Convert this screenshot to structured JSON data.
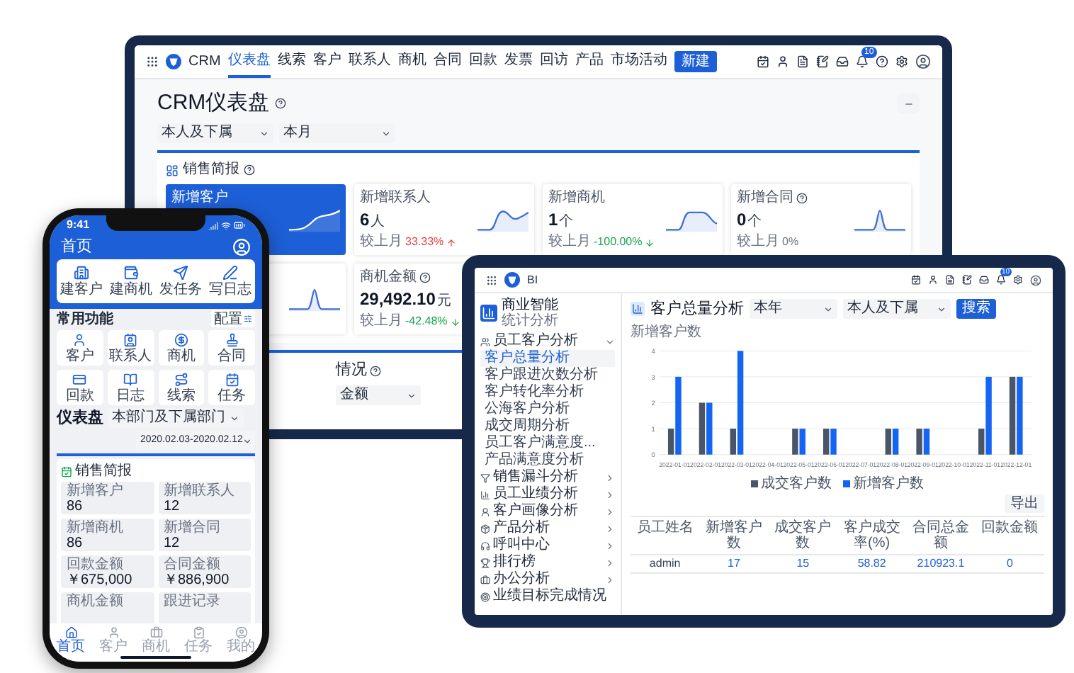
{
  "monitor": {
    "app_name": "CRM",
    "nav": [
      {
        "label": "仪表盘",
        "selected": true
      },
      {
        "label": "线索",
        "selected": false
      },
      {
        "label": "客户",
        "selected": false
      },
      {
        "label": "联系人",
        "selected": false
      },
      {
        "label": "商机",
        "selected": false
      },
      {
        "label": "合同",
        "selected": false
      },
      {
        "label": "回款",
        "selected": false
      },
      {
        "label": "发票",
        "selected": false
      },
      {
        "label": "回访",
        "selected": false
      },
      {
        "label": "产品",
        "selected": false
      },
      {
        "label": "市场活动",
        "selected": false
      }
    ],
    "new_button": "新建",
    "badge": "10",
    "title": "CRM仪表盘",
    "filters": [
      "本人及下属",
      "本月"
    ],
    "briefing": {
      "title": "销售简报",
      "cards": [
        {
          "label": "新增客户",
          "help": false,
          "selected": true,
          "sparkline": {
            "kind": "rise"
          }
        },
        {
          "label": "新增联系人",
          "help": false,
          "value": "6",
          "unit": "人",
          "compare_label": "较上月",
          "change": "33.33%",
          "arrow": {
            "kind": "up"
          },
          "selected": false,
          "sparkline": {
            "kind": "hump"
          }
        },
        {
          "label": "新增商机",
          "help": false,
          "value": "1",
          "unit": "个",
          "compare_label": "较上月",
          "change": "-100.00%",
          "arrow": {
            "kind": "down"
          },
          "selected": false,
          "sparkline": {
            "kind": "plateau"
          }
        },
        {
          "label": "新增合同",
          "help": true,
          "value": "0",
          "unit": "个",
          "compare_label": "较上月",
          "change": "0%",
          "selected": false,
          "sparkline": {
            "kind": "peak"
          }
        },
        {
          "selected": false,
          "sparkline": {
            "kind": "peak"
          }
        },
        {
          "label": "商机金额",
          "help": true,
          "value": "29,492.10",
          "unit": "元",
          "compare_label": "较上月",
          "change": "-42.48%",
          "arrow": {
            "kind": "down"
          },
          "selected": false
        }
      ]
    },
    "overview": {
      "title": "情况",
      "filter": "金额"
    }
  },
  "tablet": {
    "app_name": "BI",
    "badge": "10",
    "sidebar": {
      "title": "商业智能",
      "subtitle": "统计分析",
      "groups": [
        {
          "label": "员工客户分析",
          "expanded": true,
          "children": [
            {
              "label": "客户总量分析",
              "selected": true
            },
            {
              "label": "客户跟进次数分析",
              "selected": false
            },
            {
              "label": "客户转化率分析",
              "selected": false
            },
            {
              "label": "公海客户分析",
              "selected": false
            },
            {
              "label": "成交周期分析",
              "selected": false
            },
            {
              "label": "员工客户满意度...",
              "selected": false
            },
            {
              "label": "产品满意度分析",
              "selected": false
            }
          ]
        },
        {
          "label": "销售漏斗分析",
          "expanded": false
        },
        {
          "label": "员工业绩分析",
          "expanded": false
        },
        {
          "label": "客户画像分析",
          "expanded": false
        },
        {
          "label": "产品分析",
          "expanded": false
        },
        {
          "label": "呼叫中心",
          "expanded": false
        },
        {
          "label": "排行榜",
          "expanded": false
        },
        {
          "label": "办公分析",
          "expanded": false
        },
        {
          "label": "业绩目标完成情况"
        }
      ]
    },
    "page_title": "客户总量分析",
    "filters": [
      "本年",
      "本人及下属"
    ],
    "search_button": "搜索",
    "chart_data": {
      "type": "bar",
      "ylabel": "新增客户数",
      "categories": [
        "2022-01-01",
        "2022-02-01",
        "2022-03-01",
        "2022-04-01",
        "2022-05-01",
        "2022-06-01",
        "2022-07-01",
        "2022-08-01",
        "2022-09-01",
        "2022-10-01",
        "2022-11-01",
        "2022-12-01"
      ],
      "series": [
        {
          "name": "成交客户数",
          "color": "#4a5568",
          "values": [
            1,
            2,
            1,
            null,
            1,
            1,
            null,
            1,
            1,
            null,
            1,
            3
          ]
        },
        {
          "name": "新增客户数",
          "color": "#1565f5",
          "values": [
            3,
            2,
            4,
            null,
            1,
            1,
            null,
            1,
            1,
            null,
            3,
            3
          ]
        }
      ],
      "ylim": [
        0,
        4
      ],
      "yticks": [
        0,
        1,
        2,
        3,
        4
      ],
      "grid": true
    },
    "export_button": "导出",
    "table": {
      "columns": [
        "员工姓名",
        "新增客户数",
        "成交客户数",
        "客户成交率(%)",
        "合同总金额",
        "回款金额"
      ],
      "rows": [
        [
          "admin",
          "17",
          "15",
          "58.82",
          "210923.1",
          "0"
        ]
      ]
    }
  },
  "phone": {
    "time": "9:41",
    "title": "首页",
    "quick_actions": [
      "建客户",
      "建商机",
      "发任务",
      "写日志"
    ],
    "functions_title": "常用功能",
    "config_button": "配置",
    "functions": [
      "客户",
      "联系人",
      "商机",
      "合同",
      "回款",
      "日志",
      "线索",
      "任务"
    ],
    "dashboard": {
      "title": "仪表盘",
      "scope": "本部门及下属部门",
      "date_range": "2020.02.03-2020.02.12"
    },
    "briefing": {
      "title": "销售简报",
      "stats": [
        {
          "label": "新增客户",
          "value": "86"
        },
        {
          "label": "新增联系人",
          "value": "12"
        },
        {
          "label": "新增商机",
          "value": "86"
        },
        {
          "label": "新增合同",
          "value": "12"
        },
        {
          "label": "回款金额",
          "value": "￥675,000"
        },
        {
          "label": "合同金额",
          "value": "￥886,900"
        },
        {
          "label": "商机金额"
        },
        {
          "label": "跟进记录"
        }
      ]
    },
    "tabs": [
      {
        "label": "首页",
        "selected": true
      },
      {
        "label": "客户",
        "selected": false
      },
      {
        "label": "商机",
        "selected": false
      },
      {
        "label": "任务",
        "selected": false
      },
      {
        "label": "我的",
        "selected": false
      }
    ]
  }
}
